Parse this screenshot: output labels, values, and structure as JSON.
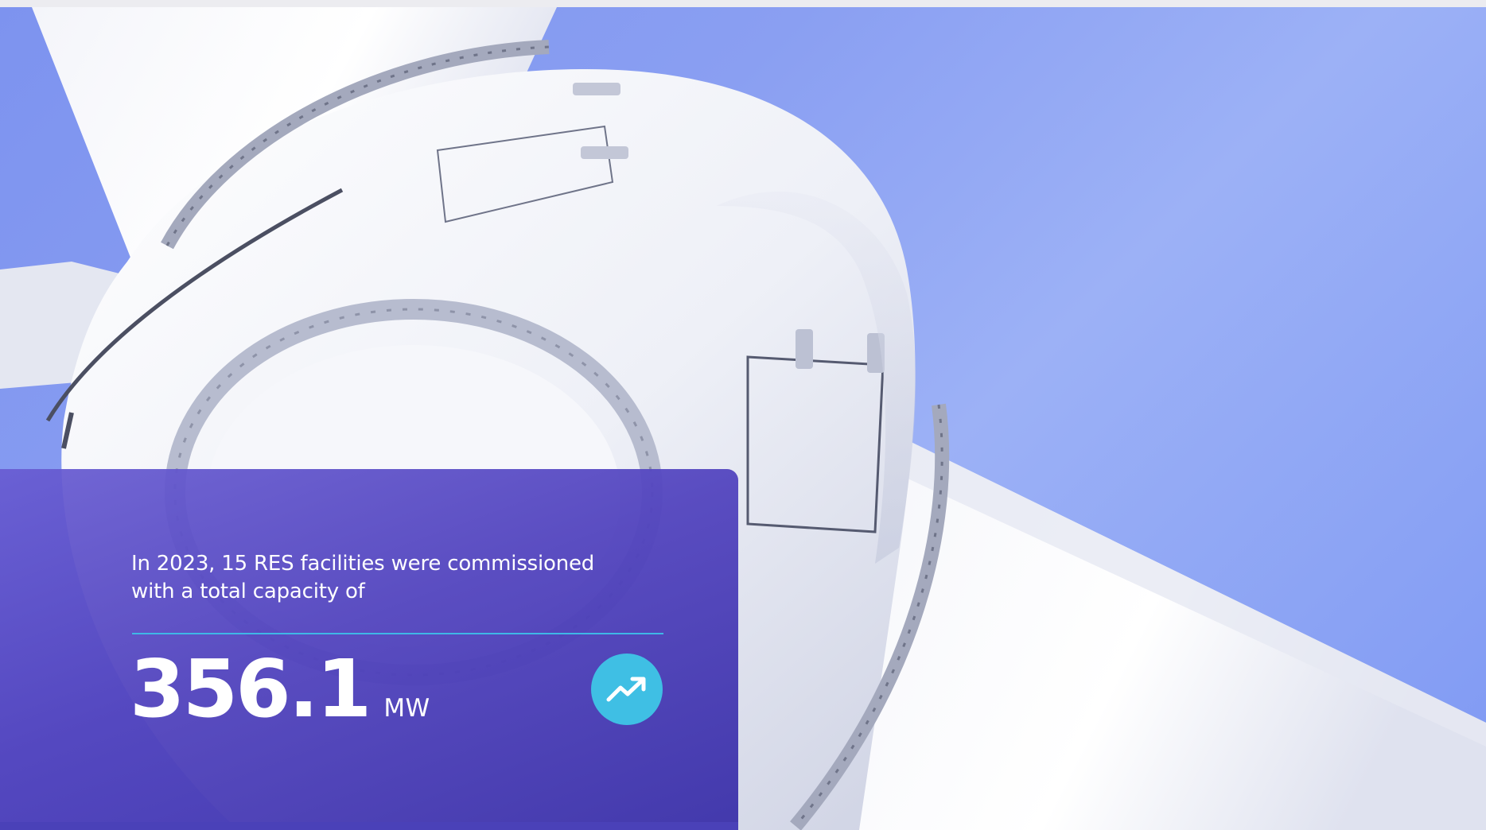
{
  "hero_image": {
    "subject": "wind turbine hub and blades against blue sky",
    "sky_color": "#8a9ff2"
  },
  "stat_card": {
    "description": "In 2023, 15 RES facilities were commissioned with a total capacity of",
    "value": "356.1",
    "unit": "MW",
    "badge_icon": "trending-up-icon",
    "colors": {
      "card": "#5a4cc8",
      "accent": "#3fbfe4",
      "divider": "#3fb7e6"
    }
  }
}
